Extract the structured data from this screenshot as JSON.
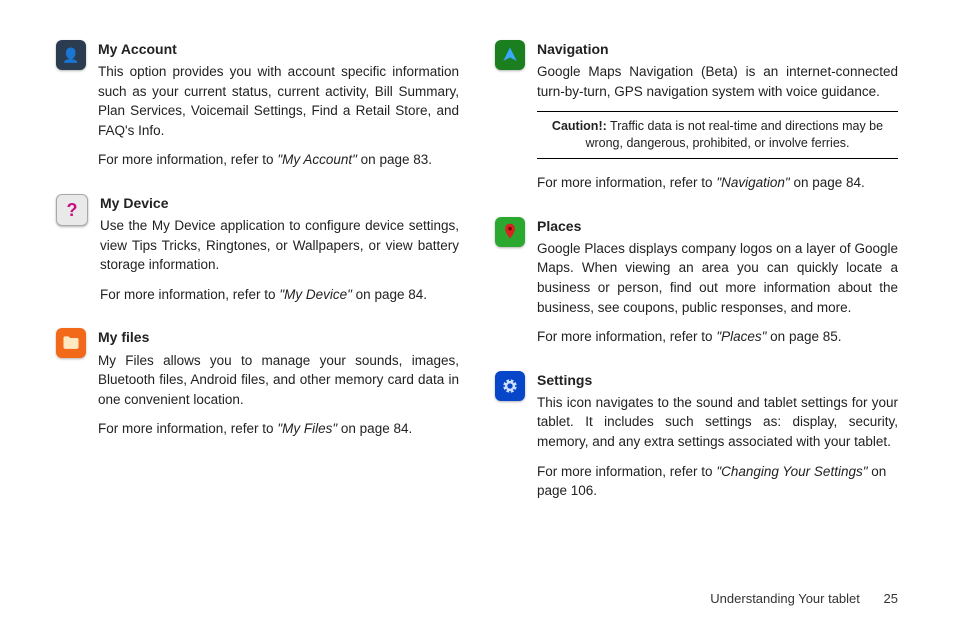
{
  "left": [
    {
      "icon": "account-icon",
      "title": "My Account",
      "desc": "This option provides you with account specific information such as your current status, current activity, Bill Summary, Plan Services, Voicemail Settings, Find a Retail Store, and FAQ's Info.",
      "ref_prefix": "For more information, refer to ",
      "ref_quote": "\"My Account\"",
      "ref_suffix": " on page 83."
    },
    {
      "icon": "help-icon",
      "title": "My Device",
      "desc": "Use the My Device application to configure device settings, view Tips Tricks, Ringtones, or Wallpapers, or view battery storage information.",
      "ref_prefix": "For more information, refer to ",
      "ref_quote": "\"My Device\"",
      "ref_suffix": " on page 84."
    },
    {
      "icon": "folder-icon",
      "title": "My files",
      "desc": "My Files allows you to manage your sounds, images, Bluetooth files, Android files, and other memory card data in one convenient location.",
      "ref_prefix": "For more information, refer to ",
      "ref_quote": "\"My Files\"",
      "ref_suffix": " on page 84."
    }
  ],
  "right": [
    {
      "icon": "navigation-arrow-icon",
      "title": "Navigation",
      "desc": "Google Maps Navigation (Beta) is an internet-connected turn-by-turn, GPS navigation system with voice guidance.",
      "caution": {
        "label": "Caution!:",
        "text": " Traffic data is not real-time and directions may be wrong, dangerous, prohibited, or involve ferries."
      },
      "ref_prefix": "For more information, refer to ",
      "ref_quote": "\"Navigation\"",
      "ref_suffix": " on page 84."
    },
    {
      "icon": "map-pin-icon",
      "title": "Places",
      "desc": "Google Places displays company logos on a layer of Google Maps. When viewing an area you can quickly locate a business or person, find out more information about the business, see coupons, public responses, and more.",
      "ref_prefix": "For more information, refer to ",
      "ref_quote": "\"Places\"",
      "ref_suffix": " on page 85."
    },
    {
      "icon": "gear-icon",
      "title": "Settings",
      "desc": "This icon navigates to the sound and tablet settings for your tablet. It includes such settings as: display, security, memory, and any extra settings associated with your tablet.",
      "ref_prefix": "For more information, refer to ",
      "ref_quote": "\"Changing Your Settings\"",
      "ref_suffix": " on page 106."
    }
  ],
  "footer": {
    "section": "Understanding Your tablet",
    "page": "25"
  }
}
